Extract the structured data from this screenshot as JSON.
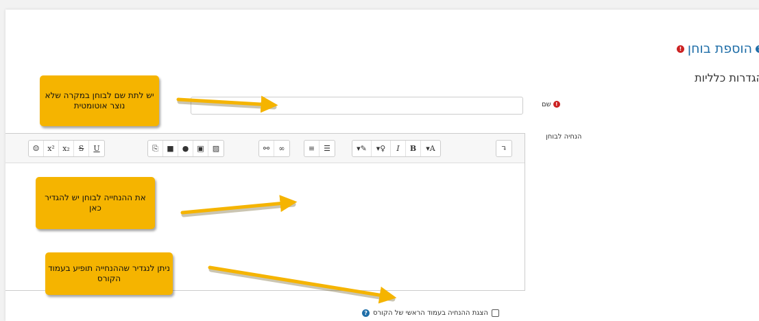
{
  "header": {
    "title": "הוספת בוחן",
    "section_title": "הגדרות כלליות"
  },
  "form": {
    "name_label": "שם",
    "description_label": "הנחיה לבוחן",
    "name_value": "",
    "show_on_course_page_label": "הצגת ההנחיה בעמוד הראשי של הקורס"
  },
  "toolbar": {
    "buttons": [
      "☺",
      "x²",
      "x₂",
      "S",
      "U",
      "⎘",
      "■",
      "🎤",
      "▣",
      "🖼",
      "⛓",
      "🔗",
      "≡",
      "☰",
      "▾✎",
      "▾♀",
      "I",
      "B",
      "▾A",
      "↴"
    ]
  },
  "callouts": {
    "name_hint": "יש לתת שם לבוחן במקרה שלא נוצר אוטומטית",
    "description_hint": "את ההנחייה לבוחן יש להגדיר כאן",
    "display_hint": "ניתן לנגדיר שההנחייה תופיע בעמוד הקורס"
  },
  "colors": {
    "accent": "#1f6ea8",
    "callout": "#f5b400",
    "required": "#cc2222"
  }
}
